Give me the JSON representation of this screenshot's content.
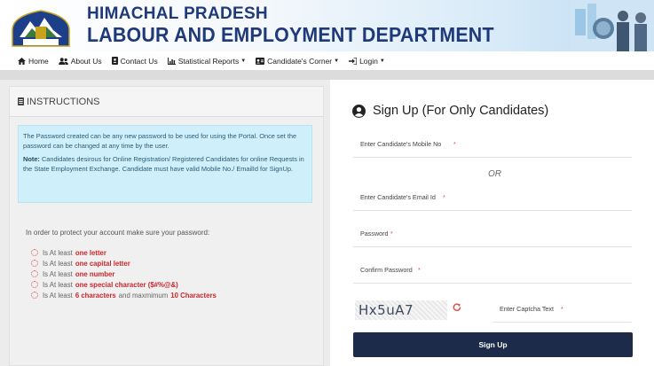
{
  "header": {
    "title_line1": "HIMACHAL PRADESH",
    "title_line2": "LABOUR AND EMPLOYMENT DEPARTMENT",
    "emblem_caption": "हिमाचल प्रदेश",
    "brand_color": "#1f3a7a"
  },
  "nav": {
    "items": [
      {
        "label": "Home",
        "icon": "home-icon"
      },
      {
        "label": "About Us",
        "icon": "users-icon"
      },
      {
        "label": "Contact Us",
        "icon": "contact-book-icon"
      },
      {
        "label": "Statistical Reports",
        "icon": "chart-icon",
        "dropdown": true
      },
      {
        "label": "Candidate's Corner",
        "icon": "id-card-icon",
        "dropdown": true
      },
      {
        "label": "Login",
        "icon": "sign-in-icon",
        "dropdown": true
      }
    ]
  },
  "instructions": {
    "heading": "INSTRUCTIONS",
    "info_para1": "The Password created can be any new password to be used for using the Portal. Once set the password can be changed at any time by the user.",
    "note_label": "Note:",
    "note_text": " Candidates desirous for Online Registration/ Registered Candidates for online Requests in the State Employment Exchange. Candidate must have valid Mobile No./ EmailId for SignUp.",
    "password_intro": "In order to protect your account make sure your password:",
    "rules": [
      {
        "prefix": "Is At least",
        "bold": "one letter"
      },
      {
        "prefix": "Is At least",
        "bold": "one capital letter"
      },
      {
        "prefix": "Is At least",
        "bold": "one number"
      },
      {
        "prefix": "Is At least",
        "bold": "one special character ($#%@&)"
      },
      {
        "prefix": "Is At least",
        "bold": "6 characters",
        "middle": "and maxmimum",
        "bold2": "10 Characters"
      }
    ]
  },
  "signup": {
    "title": "Sign Up (For Only Candidates)",
    "mobile_placeholder": "Enter Candidate's Mobile No",
    "or_text": "OR",
    "email_placeholder": "Enter Candidate's Email Id",
    "password_placeholder": "Password",
    "confirm_placeholder": "Confirm Password",
    "captcha_text": "Hx5uA7",
    "captcha_placeholder": "Enter Captcha Text",
    "required_mark": "*",
    "button_label": "Sign Up",
    "button_color": "#1c2b4a"
  }
}
